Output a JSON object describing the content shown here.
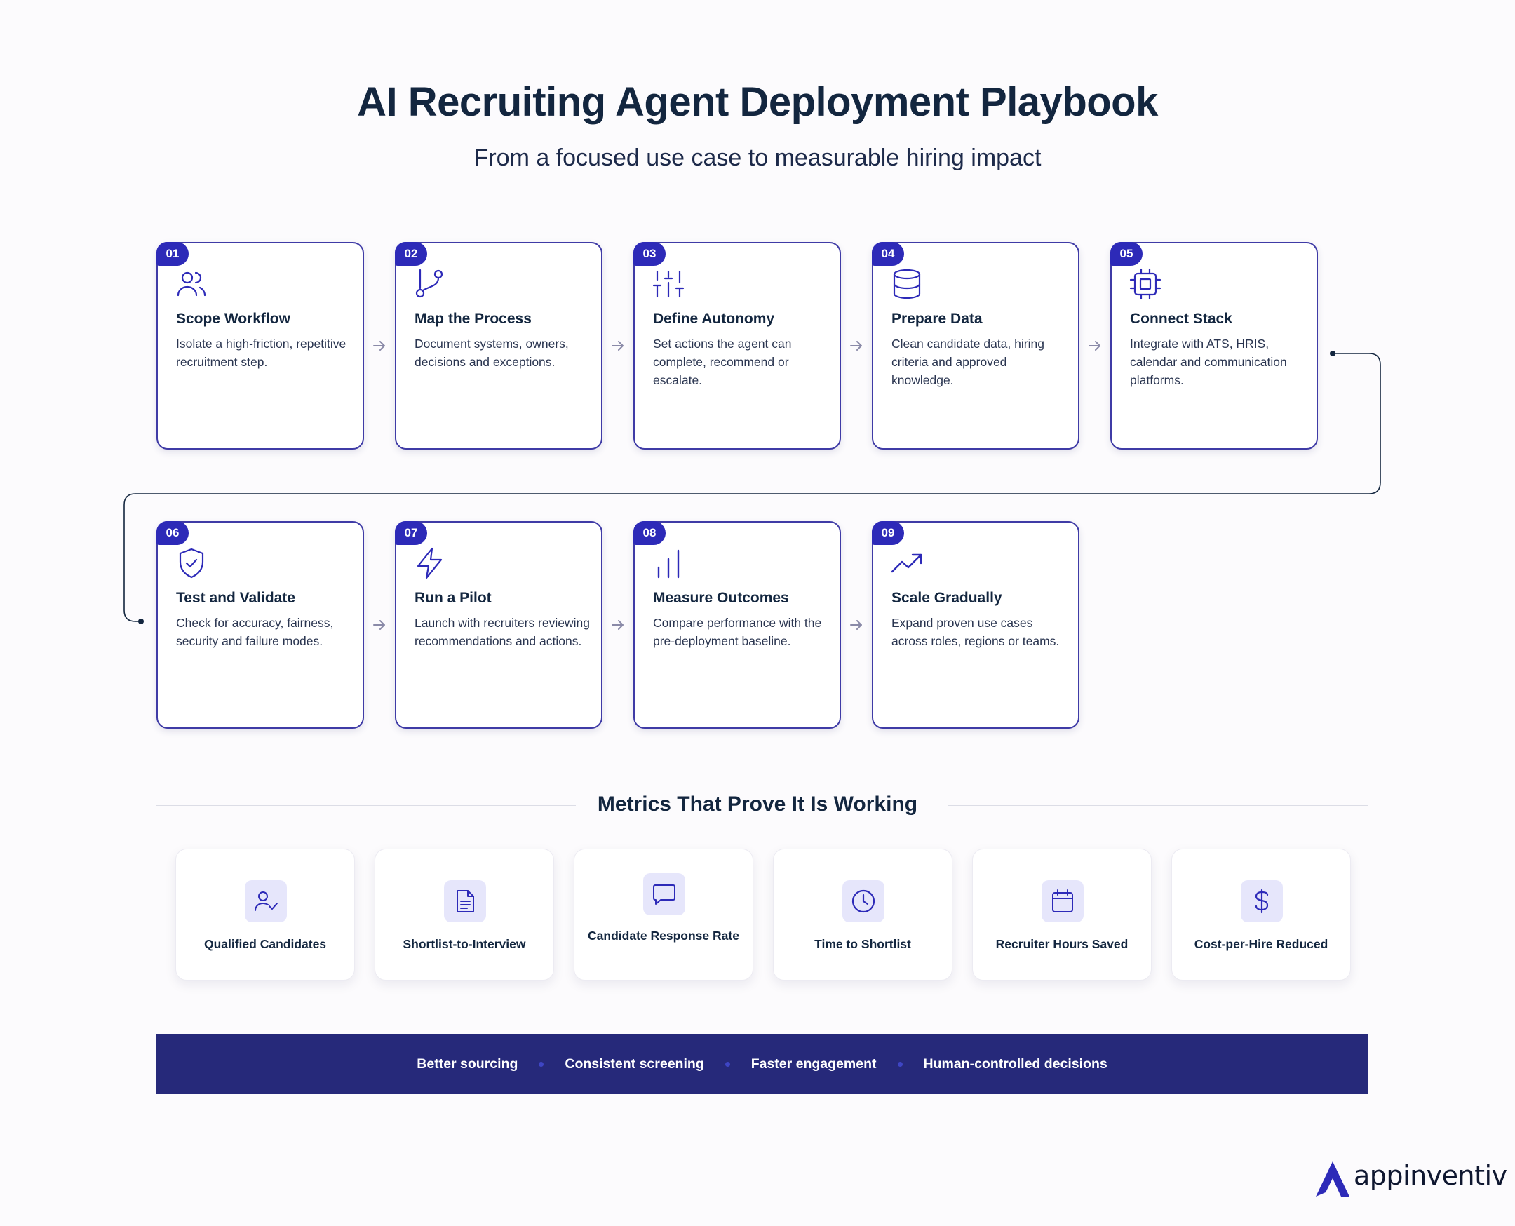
{
  "title": "AI Recruiting Agent Deployment Playbook",
  "subtitle": "From a focused use case to measurable hiring impact",
  "steps": [
    {
      "num": "01",
      "title": "Scope Workflow",
      "desc": "Isolate a high-friction, repetitive recruitment step.",
      "icon": "users-icon"
    },
    {
      "num": "02",
      "title": "Map the Process",
      "desc": "Document systems, owners, decisions and exceptions.",
      "icon": "git-branch-icon"
    },
    {
      "num": "03",
      "title": "Define Autonomy",
      "desc": "Set actions the agent can complete, recommend or escalate.",
      "icon": "sliders-icon"
    },
    {
      "num": "04",
      "title": "Prepare Data",
      "desc": "Clean candidate data, hiring criteria and approved knowledge.",
      "icon": "database-icon"
    },
    {
      "num": "05",
      "title": "Connect Stack",
      "desc": "Integrate with ATS, HRIS, calendar and communication platforms.",
      "icon": "cpu-chip-icon"
    },
    {
      "num": "06",
      "title": "Test and Validate",
      "desc": "Check for accuracy, fairness, security and failure modes.",
      "icon": "shield-check-icon"
    },
    {
      "num": "07",
      "title": "Run a Pilot",
      "desc": "Launch with recruiters reviewing recommendations and actions.",
      "icon": "lightning-icon"
    },
    {
      "num": "08",
      "title": "Measure Outcomes",
      "desc": "Compare performance with the pre-deployment baseline.",
      "icon": "bar-chart-icon"
    },
    {
      "num": "09",
      "title": "Scale Gradually",
      "desc": "Expand proven use cases across roles, regions or teams.",
      "icon": "trending-up-icon"
    }
  ],
  "metrics_heading": "Metrics That Prove It Is Working",
  "metrics": [
    {
      "label": "Qualified Candidates",
      "icon": "user-check-icon"
    },
    {
      "label": "Shortlist-to-Interview",
      "icon": "document-icon"
    },
    {
      "label": "Candidate Response Rate",
      "icon": "chat-bubble-icon"
    },
    {
      "label": "Time to Shortlist",
      "icon": "clock-icon"
    },
    {
      "label": "Recruiter Hours Saved",
      "icon": "calendar-icon"
    },
    {
      "label": "Cost-per-Hire Reduced",
      "icon": "dollar-icon"
    }
  ],
  "banner": [
    "Better sourcing",
    "Consistent screening",
    "Faster engagement",
    "Human-controlled decisions"
  ],
  "brand": "appinventiv",
  "colors": {
    "accent": "#2d2ab8",
    "border": "#3f3ba6",
    "banner": "#26297a",
    "text": "#13263f"
  }
}
